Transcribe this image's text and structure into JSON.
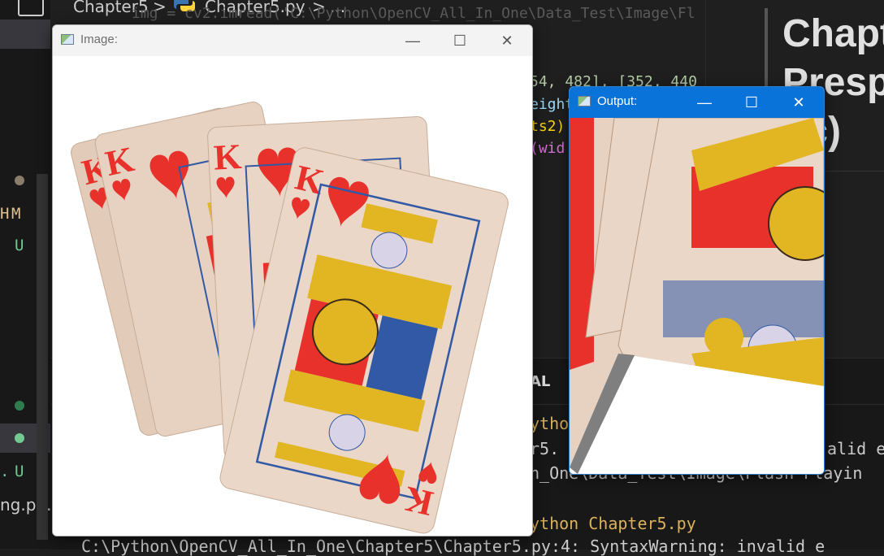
{
  "explorer": {
    "badges": [
      "M",
      "U",
      "U"
    ],
    "truncated_labels": [
      "H",
      ".",
      "ng.p..."
    ],
    "colors": {
      "modified": "#e2c08d",
      "untracked": "#73c991",
      "dot_gray": "#8b7d6b"
    }
  },
  "breadcrumb": {
    "folder": "Chapter5",
    "file": "Chapter5.py",
    "sep": ">",
    "more": "..."
  },
  "code": {
    "line_top": "img = cv2.imread('C:\\Python\\OpenCV_All_In_One\\Data_Test\\Image\\Fl",
    "line1": "54, 482], [352, 440",
    "line2": "eight",
    "line3": "ts2)",
    "line4": "(wid"
  },
  "terminal": {
    "tab_label": "AL",
    "lines": [
      "ython",
      "r5.",
      "n_One\\Data_Test\\Image\\Flash Playin",
      "ython Chapter5.py",
      "C:\\Python\\OpenCV_All_In_One\\Chapter5\\Chapter5.py:4: SyntaxWarning: invalid e"
    ],
    "right_fragment": "alid e"
  },
  "preview": {
    "heading": "Chapt\nPresp\noc)"
  },
  "image_window": {
    "title": "Image:",
    "controls": {
      "minimize": "—",
      "maximize": "☐",
      "close": "✕"
    }
  },
  "output_window": {
    "title": "Output:",
    "controls": {
      "minimize": "—",
      "maximize": "☐",
      "close": "✕"
    }
  },
  "colors": {
    "editor_bg": "#1f1f1f",
    "output_titlebar": "#0a73d9",
    "card_face": "#e8d3c4",
    "heart_red": "#e8312b",
    "gold": "#e2b623",
    "royal_blue": "#3159a5"
  }
}
